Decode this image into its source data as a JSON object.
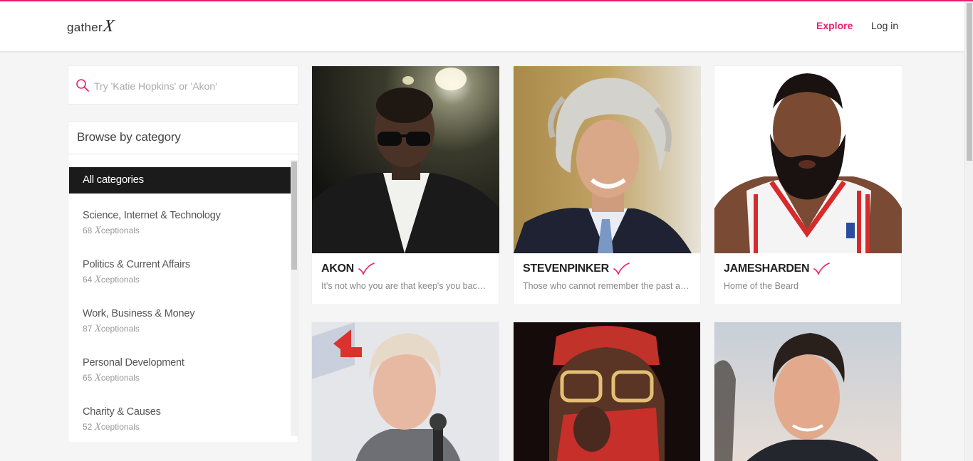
{
  "header": {
    "logo_text": "gather",
    "logo_mark": "X",
    "nav": {
      "explore": "Explore",
      "login": "Log in"
    }
  },
  "colors": {
    "accent": "#ec1e6f",
    "active_category_bg": "#1b1b1b"
  },
  "search": {
    "placeholder": "Try 'Katie Hopkins' or 'Akon'",
    "value": "",
    "icon": "search-icon"
  },
  "categories": {
    "title": "Browse by category",
    "active": "All categories",
    "count_mark": "X",
    "count_suffix": "ceptionals",
    "items": [
      {
        "name": "Science, Internet & Technology",
        "count": "68"
      },
      {
        "name": "Politics & Current Affairs",
        "count": "64"
      },
      {
        "name": "Work, Business & Money",
        "count": "87"
      },
      {
        "name": "Personal Development",
        "count": "65"
      },
      {
        "name": "Charity & Causes",
        "count": "52"
      }
    ]
  },
  "cards": [
    {
      "name": "AKON",
      "bio": "It's not who you are that keep's you back, it's who you think you're not.",
      "verified_icon": "check-icon"
    },
    {
      "name": "STEVENPINKER",
      "bio": "Those who cannot remember the past are condemned to repeat it.",
      "verified_icon": "check-icon"
    },
    {
      "name": "JAMESHARDEN",
      "bio": "Home of the Beard",
      "verified_icon": "check-icon"
    }
  ]
}
